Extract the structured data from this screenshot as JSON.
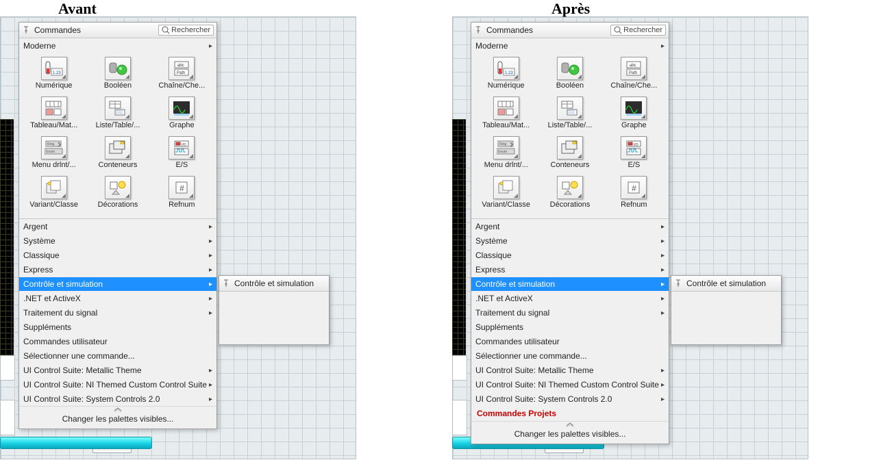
{
  "headings": {
    "before": "Avant",
    "after": "Après"
  },
  "palette": {
    "title": "Commandes",
    "search_label": "Rechercher",
    "top_category": "Moderne",
    "icons": [
      {
        "key": "numerique",
        "label": "Numérique"
      },
      {
        "key": "booleen",
        "label": "Booléen"
      },
      {
        "key": "chaine",
        "label": "Chaîne/Che..."
      },
      {
        "key": "tableau",
        "label": "Tableau/Mat..."
      },
      {
        "key": "liste",
        "label": "Liste/Table/..."
      },
      {
        "key": "graphe",
        "label": "Graphe"
      },
      {
        "key": "menudrl",
        "label": "Menu drlnt/..."
      },
      {
        "key": "conteneurs",
        "label": "Conteneurs"
      },
      {
        "key": "es",
        "label": "E/S"
      },
      {
        "key": "variant",
        "label": "Variant/Classe"
      },
      {
        "key": "decorations",
        "label": "Décorations"
      },
      {
        "key": "refnum",
        "label": "Refnum"
      }
    ],
    "categories_top": [
      {
        "label": "Argent",
        "arrow": true,
        "hl": false
      },
      {
        "label": "Système",
        "arrow": true,
        "hl": false
      },
      {
        "label": "Classique",
        "arrow": true,
        "hl": false
      },
      {
        "label": "Express",
        "arrow": true,
        "hl": false
      },
      {
        "label": "Contrôle et simulation",
        "arrow": true,
        "hl": true
      },
      {
        "label": ".NET et ActiveX",
        "arrow": true,
        "hl": false
      },
      {
        "label": "Traitement du signal",
        "arrow": true,
        "hl": false
      },
      {
        "label": "Suppléments",
        "arrow": false,
        "hl": false
      },
      {
        "label": "Commandes utilisateur",
        "arrow": false,
        "hl": false
      },
      {
        "label": "Sélectionner une commande...",
        "arrow": false,
        "hl": false
      },
      {
        "label": "UI Control Suite: Metallic Theme",
        "arrow": true,
        "hl": false
      },
      {
        "label": "UI Control Suite: NI Themed Custom Control Suite",
        "arrow": true,
        "hl": false
      },
      {
        "label": "UI Control Suite: System Controls 2.0",
        "arrow": true,
        "hl": false
      }
    ],
    "extra_after": "Commandes Projets",
    "change_palettes": "Changer les palettes visibles..."
  },
  "sub_palette": {
    "title": "Contrôle et simulation"
  }
}
